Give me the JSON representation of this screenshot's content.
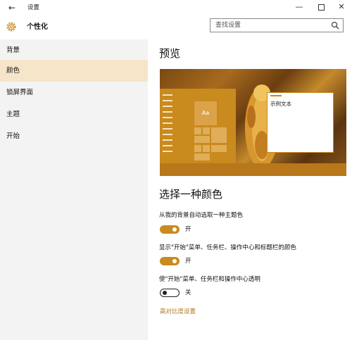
{
  "window": {
    "back_icon": "arrow-left-icon",
    "title": "设置",
    "minimize_glyph": "—",
    "close_glyph": "✕"
  },
  "header": {
    "icon": "gear-icon",
    "title": "个性化",
    "search_placeholder": "查找设置",
    "search_icon": "search-icon"
  },
  "sidebar": {
    "items": [
      {
        "label": "背景",
        "selected": false
      },
      {
        "label": "颜色",
        "selected": true
      },
      {
        "label": "锁屏界面",
        "selected": false
      },
      {
        "label": "主题",
        "selected": false
      },
      {
        "label": "开始",
        "selected": false
      }
    ],
    "selected_color": "#f6e5c8"
  },
  "main": {
    "preview_heading": "预览",
    "preview": {
      "tile_text": "Aa",
      "window_text": "示例文本"
    },
    "choose_heading": "选择一种颜色",
    "options": [
      {
        "label": "从我的背景自动选取一种主题色",
        "on": true,
        "state": "开"
      },
      {
        "label": "显示\"开始\"菜单、任务栏、操作中心和标题栏的颜色",
        "on": true,
        "state": "开"
      },
      {
        "label": "使\"开始\"菜单、任务栏和操作中心透明",
        "on": false,
        "state": "关"
      }
    ],
    "link": "高对比度设置"
  },
  "colors": {
    "accent": "#c98a1e",
    "link": "#b07820"
  }
}
